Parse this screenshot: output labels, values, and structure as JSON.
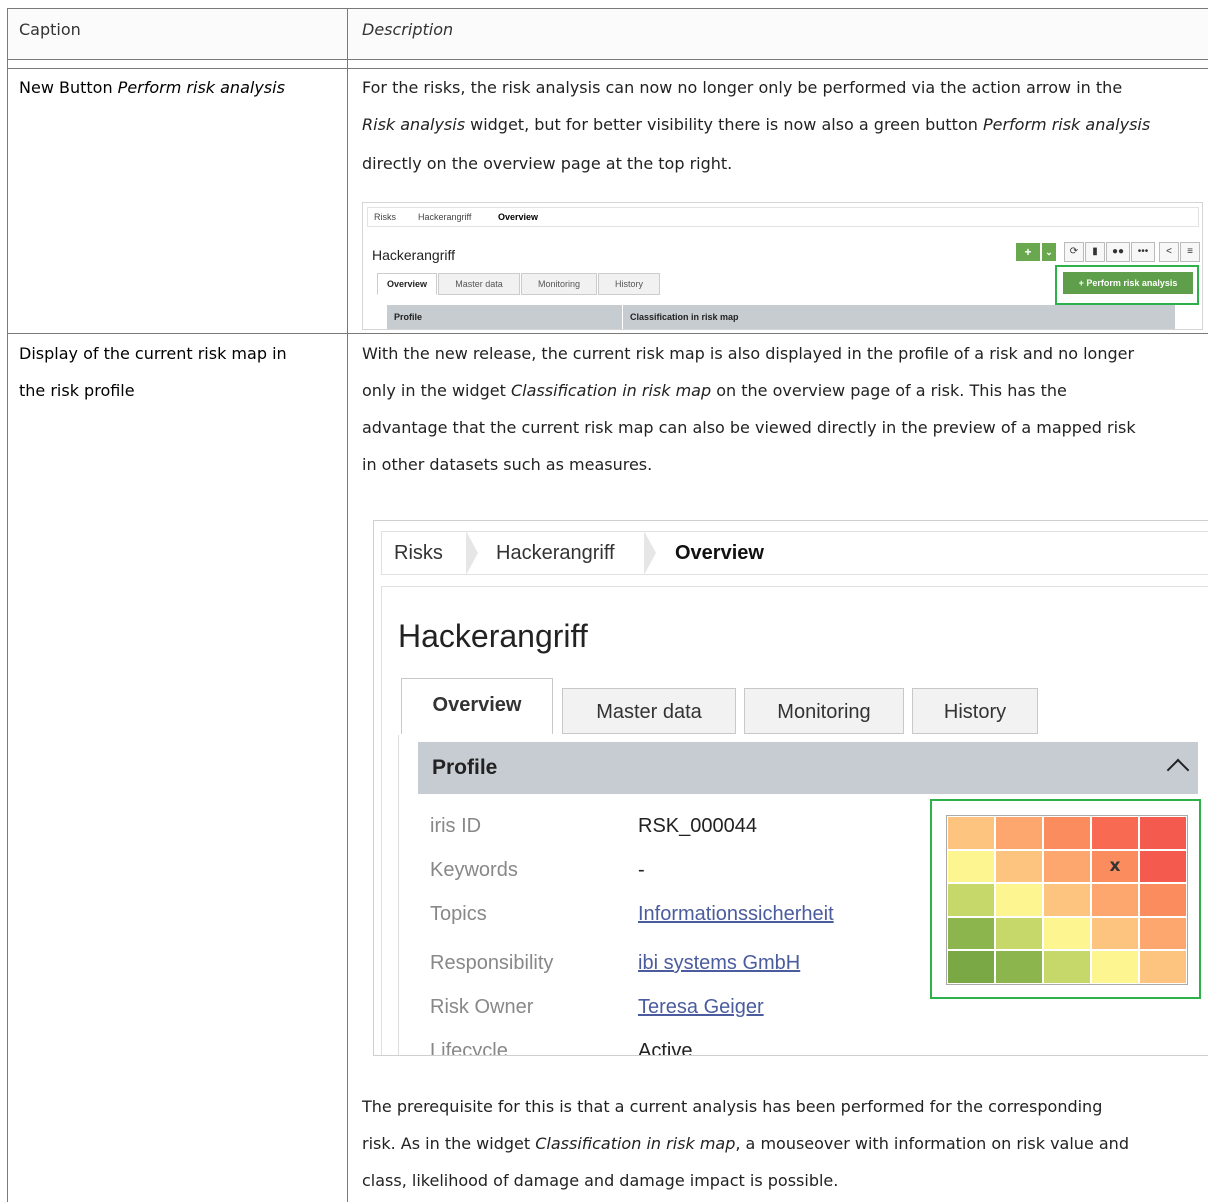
{
  "header": {
    "col1": "Caption",
    "col2": "Description"
  },
  "row1": {
    "caption_prefix": "New Button ",
    "caption_italic": "Perform risk analysis",
    "desc_a": "For the risks, the risk analysis can now no longer only be performed via the action arrow in the",
    "desc_b_italic": "Risk analysis",
    "desc_b_mid": " widget, but for better visibility there is now also a green button ",
    "desc_b_italic2": "Perform risk analysis",
    "desc_c": "directly on the overview page at the top right."
  },
  "shot1": {
    "breadcrumb": [
      "Risks",
      "Hackerangriff",
      "Overview"
    ],
    "title": "Hackerangriff",
    "tabs": [
      "Overview",
      "Master data",
      "Monitoring",
      "History"
    ],
    "button": "+ Perform risk analysis",
    "bar_left": "Profile",
    "bar_right": "Classification in risk map",
    "colors": {
      "green": "#5f9e4a",
      "highlight": "#2db14a"
    }
  },
  "row2": {
    "caption_a": "Display of the current risk map in",
    "caption_b": "the risk profile",
    "desc_a": "With the new release, the current risk map is also displayed in the profile of a risk and no longer",
    "desc_b_pre": "only in the widget ",
    "desc_b_italic": "Classification in risk map",
    "desc_b_post": " on the overview page of a risk. This has the",
    "desc_c": "advantage that the current risk map can also be viewed directly in the preview of a mapped risk",
    "desc_d": "in other datasets such as measures.",
    "post_a": "The prerequisite for this is that a current analysis has been performed for the corresponding",
    "post_b_pre": "risk. As in the widget ",
    "post_b_italic": "Classification in risk map",
    "post_b_post": ", a mouseover with information on risk value and",
    "post_c": "class, likelihood of damage and damage impact is possible."
  },
  "shot2": {
    "breadcrumb": [
      "Risks",
      "Hackerangriff",
      "Overview"
    ],
    "title": "Hackerangriff",
    "tabs": [
      "Overview",
      "Master data",
      "Monitoring",
      "History"
    ],
    "section": "Profile",
    "fields": [
      {
        "label": "iris ID",
        "value": "RSK_000044",
        "link": false
      },
      {
        "label": "Keywords",
        "value": "-",
        "link": false
      },
      {
        "label": "Topics",
        "value": "Informationssicherheit",
        "link": true
      },
      {
        "label": "Responsibility",
        "value": "ibi systems GmbH",
        "link": true
      },
      {
        "label": "Risk Owner",
        "value": "Teresa Geiger",
        "link": true
      },
      {
        "label": "Lifecycle",
        "value": "Active",
        "link": false
      }
    ],
    "risk_map": {
      "marker": "x",
      "cells": [
        [
          "#fdc47f",
          "#fda66e",
          "#fb8c5e",
          "#f86a52",
          "#f45a4d"
        ],
        [
          "#fdf590",
          "#fdc47f",
          "#fda66e",
          "#fb8c5e",
          "#f45a4d"
        ],
        [
          "#c6d86a",
          "#fdf590",
          "#fdc47f",
          "#fda66e",
          "#fb8c5e"
        ],
        [
          "#8db54e",
          "#c6d86a",
          "#fdf590",
          "#fdc47f",
          "#fda66e"
        ],
        [
          "#7aa845",
          "#8db54e",
          "#c6d86a",
          "#fdf590",
          "#fdc47f"
        ]
      ],
      "marker_row": 1,
      "marker_col": 3
    }
  }
}
